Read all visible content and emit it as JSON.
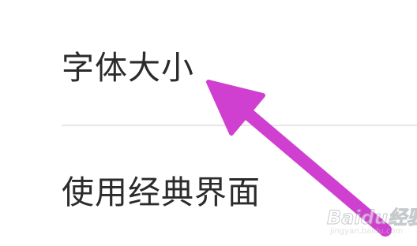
{
  "settings": {
    "items": [
      {
        "label": "字体大小"
      },
      {
        "label": "使用经典界面"
      }
    ]
  },
  "annotation": {
    "arrow_color": "#d040d0",
    "icon": "arrow-pointer-icon"
  },
  "watermark": {
    "brand": "Baidu经验",
    "url": "jingyan.baidu.com"
  }
}
